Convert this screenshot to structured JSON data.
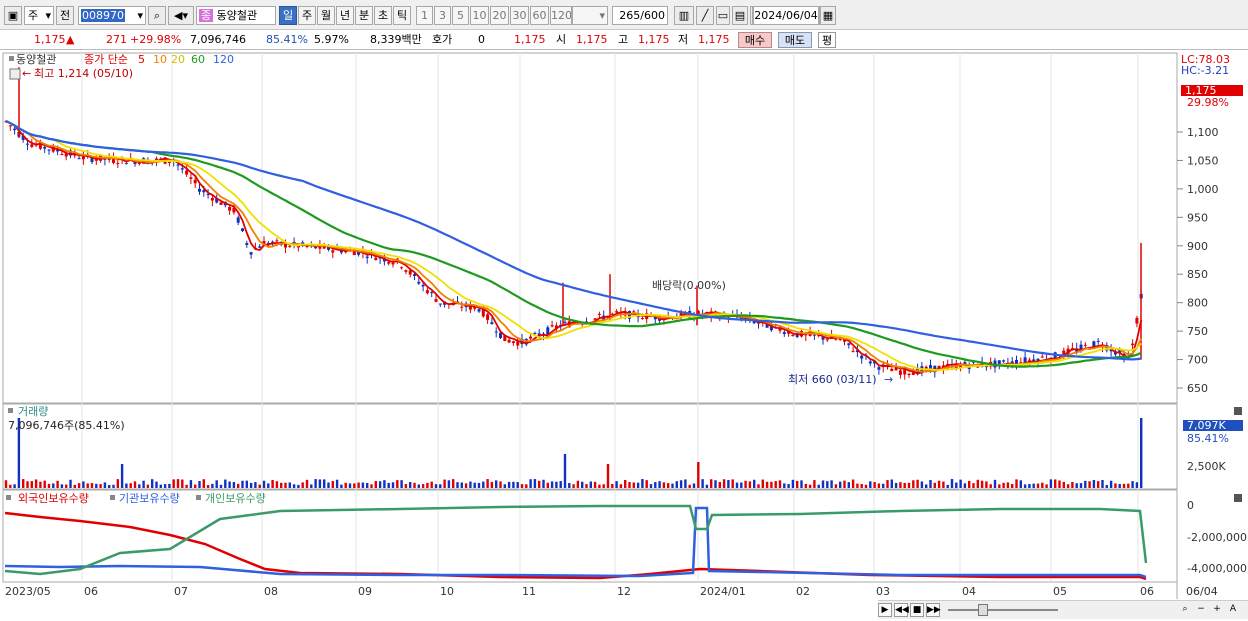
{
  "toolbar": {
    "type_select": "주",
    "prev_label": "전",
    "stock_code": "008970",
    "stock_name": "동양철관",
    "stock_badge": "종",
    "periods": [
      "일",
      "주",
      "월",
      "년",
      "분",
      "초",
      "틱"
    ],
    "selected_period": "일",
    "intervals": [
      "1",
      "3",
      "5",
      "10",
      "20",
      "30",
      "60",
      "120"
    ],
    "count": "265",
    "max_count": "/600",
    "date": "2024/06/04"
  },
  "quote": {
    "price": "1,175",
    "change": "271",
    "change_pct": "+29.98%",
    "volume": "7,096,746",
    "vol_ratio": "85.41%",
    "turnover": "5.97%",
    "amount": "8,339백만",
    "hoga_label": "호가",
    "hoga_value": "0",
    "hoga_price": "1,175",
    "open_label": "시",
    "open": "1,175",
    "high_label": "고",
    "high": "1,175",
    "low_label": "저",
    "low": "1,175",
    "buy_label": "매수",
    "sell_label": "매도",
    "eval_label": "평"
  },
  "price_panel": {
    "stock_name": "동양철관",
    "legend_title": "종가 단순",
    "ma_labels": [
      "5",
      "10",
      "20",
      "60",
      "120"
    ],
    "ma_colors": [
      "#e00000",
      "#f08000",
      "#f0e000",
      "#1e9a1e",
      "#3060e0"
    ],
    "high_note": "최고 1,214 (05/10)",
    "low_note": "최저 660 (03/11)",
    "event_note": "배당락(0.00%)",
    "lc": "LC:78.03",
    "hc": "HC:-3.21",
    "last_price": "1,175",
    "last_pct": "29.98%",
    "y_ticks": [
      "1,100",
      "1,050",
      "1,000",
      "950",
      "900",
      "850",
      "800",
      "750",
      "700",
      "650"
    ]
  },
  "volume_panel": {
    "title": "거래량",
    "value_text": "7,096,746주(85.41%)",
    "last": "7,097K",
    "last_pct": "85.41%",
    "y_ticks": [
      "2,500K"
    ]
  },
  "holding_panel": {
    "legend": [
      "외국인보유수량",
      "기관보유수량",
      "개인보유수량"
    ],
    "legend_colors": [
      "#e00000",
      "#3060e0",
      "#3a9a6a"
    ],
    "y_ticks": [
      "0",
      "-2,000,000",
      "-4,000,000"
    ]
  },
  "x_axis": {
    "labels": [
      "2023/05",
      "06",
      "07",
      "08",
      "09",
      "10",
      "11",
      "12",
      "2024/01",
      "02",
      "03",
      "04",
      "05",
      "06"
    ],
    "right_label": "06/04"
  },
  "chart_data": {
    "type": "line",
    "series": [
      {
        "name": "종가",
        "x": [
          "2023/05",
          "2023/06",
          "2023/07",
          "2023/08",
          "2023/09",
          "2023/10",
          "2023/11",
          "2023/12",
          "2024/01",
          "2024/02",
          "2024/03",
          "2024/04",
          "2024/05",
          "2024/06/04"
        ],
        "values": [
          1130,
          1060,
          1040,
          920,
          900,
          800,
          740,
          780,
          770,
          750,
          690,
          690,
          720,
          1175
        ]
      },
      {
        "name": "120",
        "values": [
          1035,
          1045,
          1045,
          1025,
          990,
          940,
          895,
          860,
          835,
          805,
          770,
          745,
          735,
          735
        ]
      }
    ],
    "volume_last": 7096746
  }
}
